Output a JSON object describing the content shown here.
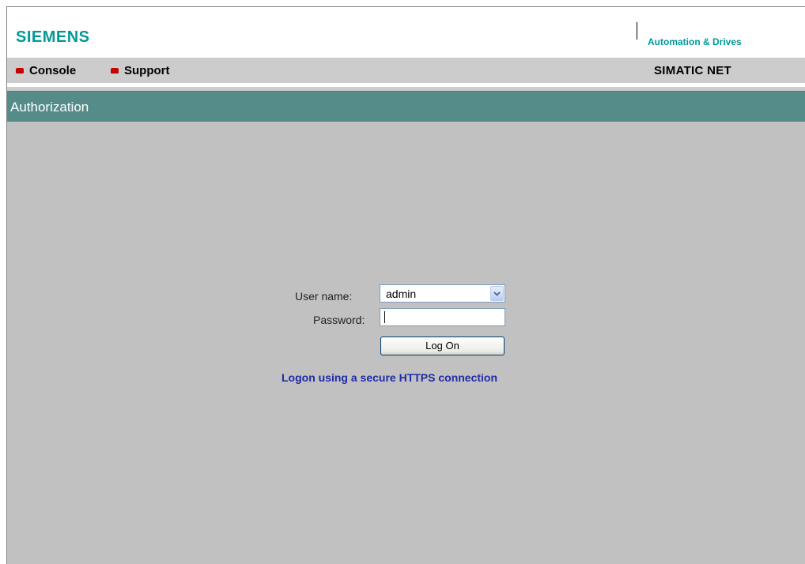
{
  "header": {
    "brand": "SIEMENS",
    "tagline": "Automation & Drives"
  },
  "nav": {
    "items": [
      {
        "label": "Console"
      },
      {
        "label": "Support"
      }
    ],
    "product": "SIMATIC NET"
  },
  "page": {
    "title": "Authorization"
  },
  "login": {
    "username_label": "User name:",
    "username_value": "admin",
    "password_label": "Password:",
    "password_value": "",
    "submit_label": "Log On",
    "https_link": "Logon using a secure HTTPS connection"
  },
  "colors": {
    "brand": "#009999",
    "titlebar": "#558b89",
    "nav_bullet": "#cc0000",
    "content_bg": "#c1c1c1",
    "link": "#1f2aa8"
  }
}
